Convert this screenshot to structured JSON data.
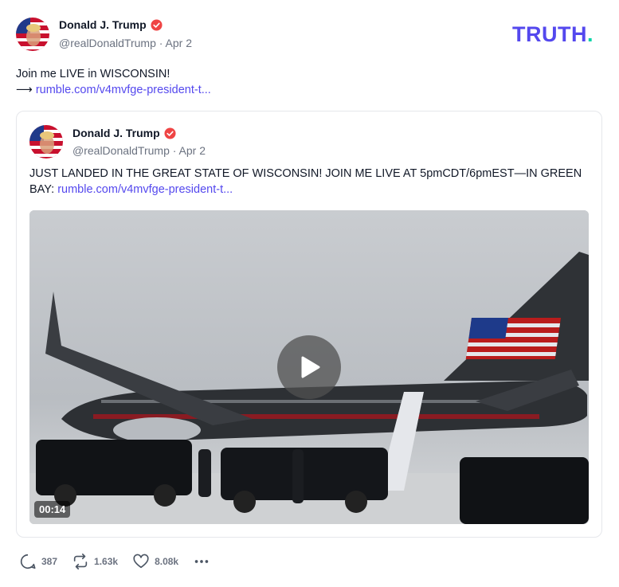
{
  "brand": {
    "logo_text": "TRUTH",
    "logo_dot": ".",
    "accent": "#5448ee",
    "dot_color": "#00d4a6"
  },
  "post": {
    "author": {
      "name": "Donald J. Trump",
      "handle": "@realDonaldTrump",
      "date": "Apr 2",
      "verified_icon": "verified-badge-icon"
    },
    "text_line1": "Join me LIVE in WISCONSIN!",
    "arrow": "⟶",
    "link_text": "rumble.com/v4mvfge-president-t..."
  },
  "quote": {
    "author": {
      "name": "Donald J. Trump",
      "handle": "@realDonaldTrump",
      "date": "Apr 2"
    },
    "text": "JUST LANDED IN THE GREAT STATE OF WISCONSIN! JOIN ME LIVE AT 5pmCDT/6pmEST—IN GREEN BAY: ",
    "link_text": "rumble.com/v4mvfge-president-t...",
    "video": {
      "duration": "00:14",
      "play_icon": "play-icon"
    }
  },
  "actions": {
    "reply_count": "387",
    "retruth_count": "1.63k",
    "like_count": "8.08k",
    "more_icon": "ellipsis-icon"
  }
}
